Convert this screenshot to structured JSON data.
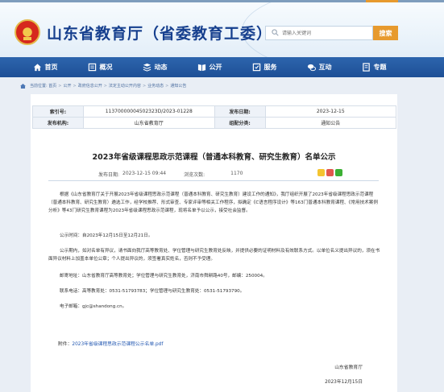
{
  "header": {
    "site_title": "山东省教育厅（省委教育工委）",
    "search_placeholder": "请输入关键词",
    "search_button": "搜索"
  },
  "nav": {
    "items": [
      {
        "label": "首页",
        "icon": "home-icon"
      },
      {
        "label": "概况",
        "icon": "overview-icon"
      },
      {
        "label": "动态",
        "icon": "news-icon"
      },
      {
        "label": "公开",
        "icon": "book-icon"
      },
      {
        "label": "服务",
        "icon": "service-icon"
      },
      {
        "label": "互动",
        "icon": "chat-icon"
      },
      {
        "label": "专题",
        "icon": "topic-icon"
      }
    ]
  },
  "breadcrumb": {
    "items": [
      "当前位置: 首页",
      "公开",
      "政府信息公开",
      "法定主动公开内容",
      "业务动态",
      "通知公告"
    ],
    "separator": ">"
  },
  "meta": {
    "index_label": "索引号:",
    "index_value": "11370000004502323D/2023-01228",
    "date_label": "发布日期:",
    "date_value": "2023-12-15",
    "org_label": "发布机构:",
    "org_value": "山东省教育厅",
    "category_label": "组配分类:",
    "category_value": "通知公告"
  },
  "article": {
    "title": "2023年省级课程思政示范课程（普通本科教育、研究生教育）名单公示",
    "pub_date_label": "发布日期:",
    "pub_date_value": "2023-12-15 09:44",
    "views_label": "浏览次数:",
    "views_value": "1170",
    "para1": "根据《山东省教育厅关于开展2023年省级课程思政示范课程（普通本科教育、研究生教育）建设工作的通知》，我厅组织开展了2023年省级课程思政示范课程（普通本科教育、研究生教育）遴选工作，经学校推荐、形式审查、专家评审等相关工作程序，拟确定《C语言程序设计》等163门普通本科教育课程、《常用技术案例分析》等43门研究生教育课程为2023年省级课程思政示范课程，现将名单予以公示，接受社会监督。",
    "para2": "公示时间：自2023年12月15日至12月21日。",
    "para3": "公示期内，如对名单有异议，请书面向我厅高等教育处、学位管理与研究生教育处反映，并提供必要的证明材料及有效联系方式。以单位名义提出异议的，须在书面异议材料上加盖本单位公章；个人提出异议的，须签署真实姓名，否则不予受理。",
    "para4": "邮寄地址：山东省教育厅高等教育处；学位管理与研究生教育处，济南市舜耕路40号，邮编：250004。",
    "para5": "联系电话：高等教育处：0531-51793783；学位管理与研究生教育处：0531-51793790。",
    "para6": "电子邮箱：gjc@shandong.cn。",
    "attachment_label": "附件：",
    "attachment_link": "2023年省级课程思政示范课程公示名单.pdf",
    "sign_org": "山东省教育厅",
    "sign_date": "2023年12月15日"
  },
  "colors": {
    "nav_bg": "#1d4f96",
    "title_blue": "#163f8e",
    "accent_orange": "#e79a2e",
    "link_blue": "#1f55b0"
  }
}
